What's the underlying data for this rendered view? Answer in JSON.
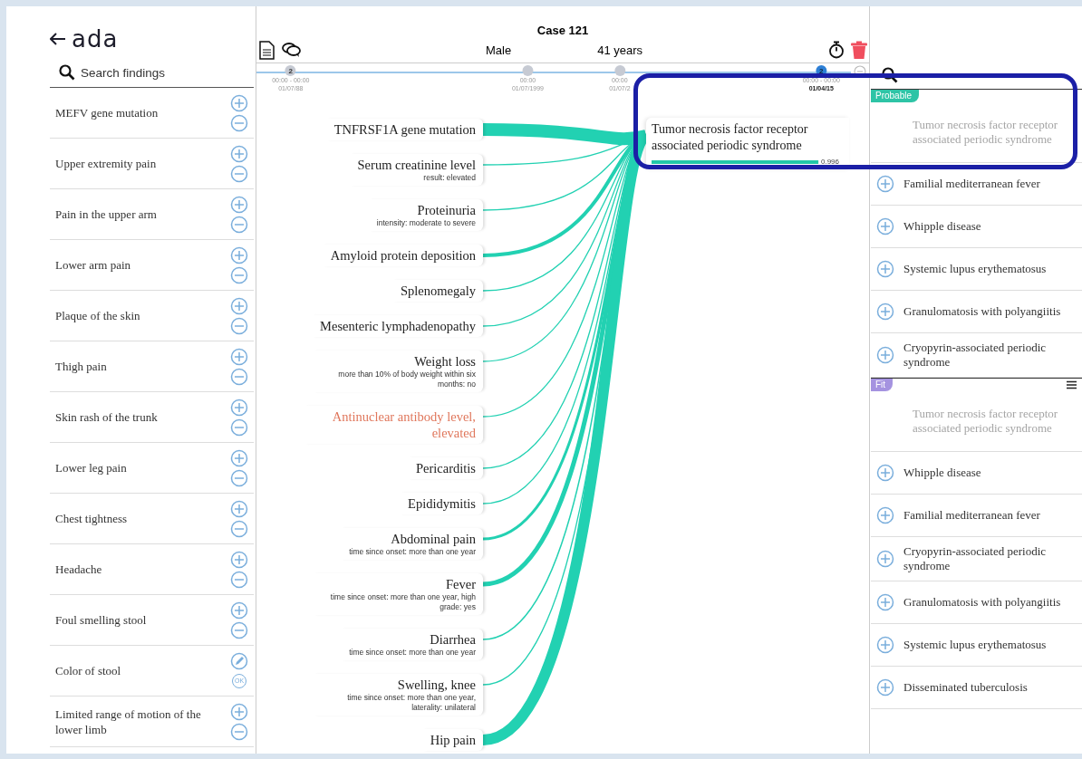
{
  "logo": "ada",
  "search_findings": {
    "placeholder": "Search findings"
  },
  "findings_list": [
    {
      "name": "MEFV gene mutation",
      "kind": "add_remove"
    },
    {
      "name": "Upper extremity pain",
      "kind": "add_remove"
    },
    {
      "name": "Pain in the upper arm",
      "kind": "add_remove"
    },
    {
      "name": "Lower arm pain",
      "kind": "add_remove"
    },
    {
      "name": "Plaque of the skin",
      "kind": "add_remove"
    },
    {
      "name": "Thigh pain",
      "kind": "add_remove"
    },
    {
      "name": "Skin rash of the trunk",
      "kind": "add_remove"
    },
    {
      "name": "Lower leg pain",
      "kind": "add_remove"
    },
    {
      "name": "Chest tightness",
      "kind": "add_remove"
    },
    {
      "name": "Headache",
      "kind": "add_remove"
    },
    {
      "name": "Foul smelling stool",
      "kind": "add_remove"
    },
    {
      "name": "Color of stool",
      "kind": "edit_ok",
      "ok_label": "OK"
    },
    {
      "name": "Limited range of motion of the lower limb",
      "kind": "add_remove"
    }
  ],
  "case": {
    "title": "Case 121",
    "sex": "Male",
    "age": "41 years"
  },
  "timeline": [
    {
      "count": "2",
      "time": "00:00 - 00:00",
      "date": "01/07/88",
      "selected": false
    },
    {
      "time": "00:00",
      "date": "01/07/1999",
      "selected": false
    },
    {
      "time": "00:00",
      "date": "01/07/2",
      "selected": false
    },
    {
      "count": "2",
      "time": "00:00 - 00:00",
      "date": "01/04/15",
      "selected": true
    }
  ],
  "case_findings": [
    {
      "name": "TNFRSF1A gene mutation",
      "flagged": false
    },
    {
      "name": "Serum creatinine level",
      "detail": "result: elevated",
      "flagged": false
    },
    {
      "name": "Proteinuria",
      "detail": "intensity: moderate to severe",
      "flagged": false
    },
    {
      "name": "Amyloid protein deposition",
      "flagged": false
    },
    {
      "name": "Splenomegaly",
      "flagged": false
    },
    {
      "name": "Mesenteric lymphadenopathy",
      "flagged": false
    },
    {
      "name": "Weight loss",
      "detail": "more than 10% of body weight within six months: no",
      "flagged": false
    },
    {
      "name": "Antinuclear antibody level, elevated",
      "flagged": true
    },
    {
      "name": "Pericarditis",
      "flagged": false
    },
    {
      "name": "Epididymitis",
      "flagged": false
    },
    {
      "name": "Abdominal pain",
      "detail": "time since onset: more than one year",
      "flagged": false
    },
    {
      "name": "Fever",
      "detail": "time since onset: more than one year, high grade: yes",
      "flagged": false
    },
    {
      "name": "Diarrhea",
      "detail": "time since onset: more than one year",
      "flagged": false
    },
    {
      "name": "Swelling, knee",
      "detail": "time since onset: more than one year, laterality: unilateral",
      "flagged": false
    },
    {
      "name": "Hip pain",
      "flagged": false
    }
  ],
  "diagnosis": {
    "name": "Tumor necrosis factor receptor associated periodic syndrome",
    "level": 0.996,
    "score": "0.996"
  },
  "condition_sections": [
    {
      "tag": "Probable",
      "color": "#2ec4a6",
      "menu": false,
      "items": [
        {
          "name": "Tumor necrosis factor receptor associated periodic syndrome",
          "selected": true
        },
        {
          "name": "Familial mediterranean fever",
          "selected": false
        },
        {
          "name": "Whipple disease",
          "selected": false
        },
        {
          "name": "Systemic lupus erythematosus",
          "selected": false
        },
        {
          "name": "Granulomatosis with polyangiitis",
          "selected": false
        },
        {
          "name": "Cryopyrin-associated periodic syndrome",
          "selected": false
        }
      ]
    },
    {
      "tag": "Fit",
      "color": "#a593e0",
      "menu": true,
      "items": [
        {
          "name": "Tumor necrosis factor receptor associated periodic syndrome",
          "selected": true
        },
        {
          "name": "Whipple disease",
          "selected": false
        },
        {
          "name": "Familial mediterranean fever",
          "selected": false
        },
        {
          "name": "Cryopyrin-associated periodic syndrome",
          "selected": false
        },
        {
          "name": "Granulomatosis with polyangiitis",
          "selected": false
        },
        {
          "name": "Systemic lupus erythematosus",
          "selected": false
        },
        {
          "name": "Disseminated tuberculosis",
          "selected": false
        }
      ]
    }
  ],
  "annotation": {
    "kind": "frame"
  }
}
